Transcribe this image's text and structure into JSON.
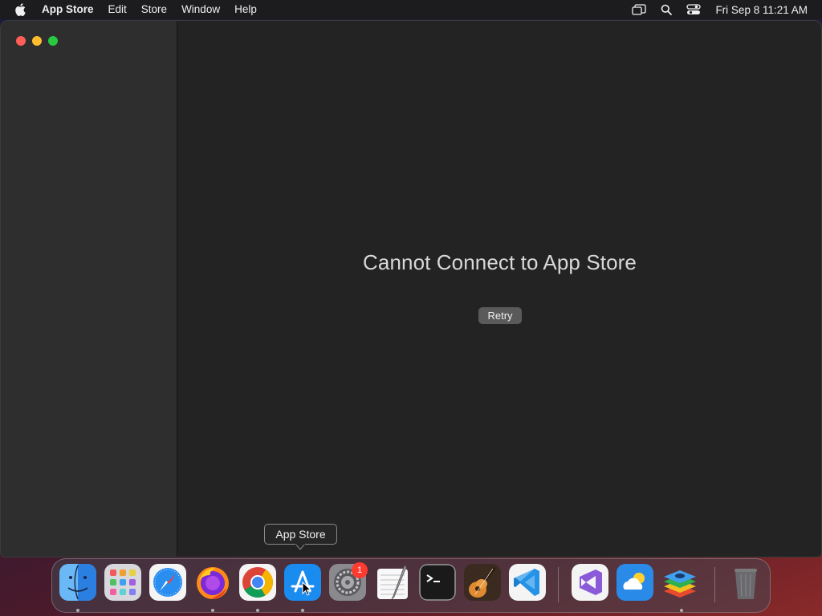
{
  "menubar": {
    "apple_icon": "apple-logo-icon",
    "app_name": "App Store",
    "items": [
      "Edit",
      "Store",
      "Window",
      "Help"
    ],
    "status_icons": [
      "screen-mirroring-icon",
      "spotlight-search-icon",
      "control-center-icon"
    ],
    "clock": "Fri Sep 8  11:21 AM"
  },
  "window": {
    "error_title": "Cannot Connect to App Store",
    "retry_label": "Retry"
  },
  "tooltip": {
    "label": "App Store"
  },
  "dock": {
    "items": [
      {
        "name": "Finder",
        "icon": "finder-icon",
        "running": true
      },
      {
        "name": "Launchpad",
        "icon": "launchpad-icon",
        "running": false
      },
      {
        "name": "Safari",
        "icon": "safari-icon",
        "running": false
      },
      {
        "name": "Firefox",
        "icon": "firefox-icon",
        "running": true
      },
      {
        "name": "Chrome",
        "icon": "chrome-icon",
        "running": true
      },
      {
        "name": "App Store",
        "icon": "app-store-icon",
        "running": true
      },
      {
        "name": "System Preferences",
        "icon": "system-preferences-icon",
        "running": false,
        "badge": "1"
      },
      {
        "name": "TextEdit",
        "icon": "textedit-icon",
        "running": false
      },
      {
        "name": "Terminal",
        "icon": "terminal-icon",
        "running": false
      },
      {
        "name": "GarageBand",
        "icon": "garageband-icon",
        "running": false
      },
      {
        "name": "Visual Studio Code",
        "icon": "vscode-icon",
        "running": false
      },
      {
        "name": "Visual Studio",
        "icon": "visual-studio-icon",
        "running": false
      },
      {
        "name": "Weather",
        "icon": "weather-icon",
        "running": false
      },
      {
        "name": "BlueStacks",
        "icon": "bluestacks-icon",
        "running": true
      },
      {
        "name": "Trash",
        "icon": "trash-icon",
        "running": false
      }
    ],
    "badge": "1"
  },
  "colors": {
    "close": "#ff5f57",
    "minimize": "#febc2e",
    "maximize": "#28c840",
    "badge": "#ff3b30"
  }
}
